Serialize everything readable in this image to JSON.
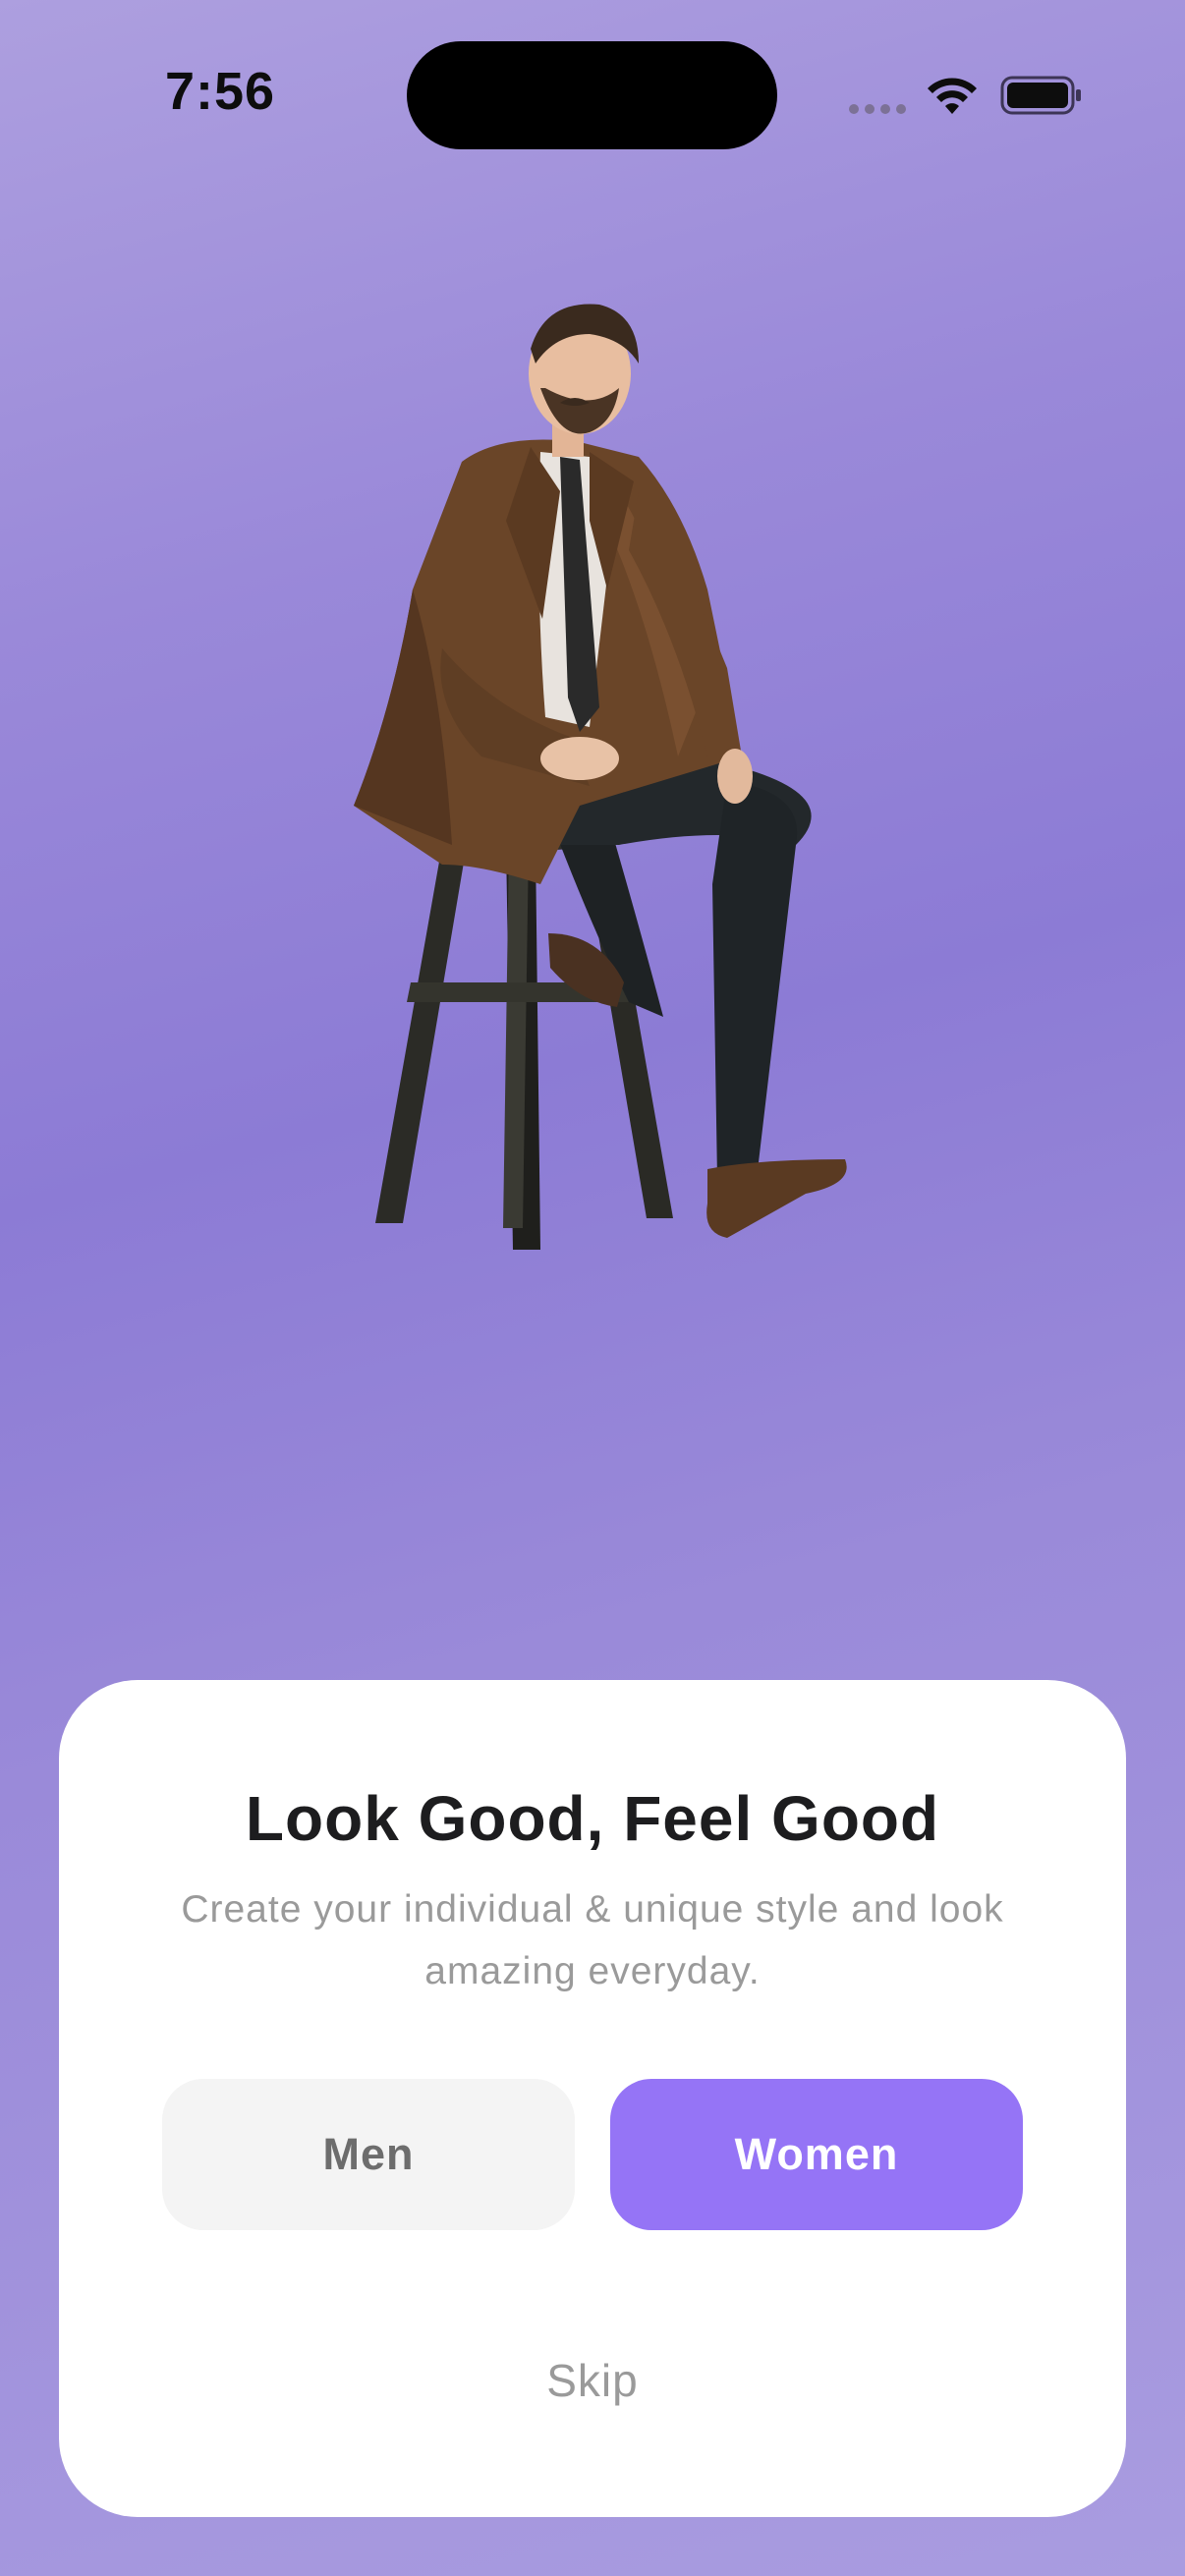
{
  "status_bar": {
    "time": "7:56"
  },
  "hero": {
    "image_alt": "Man in brown trench coat sitting on wooden bar stool"
  },
  "card": {
    "title": "Look Good, Feel Good",
    "subtitle": "Create your individual & unique style and look amazing everyday.",
    "buttons": {
      "men_label": "Men",
      "women_label": "Women"
    },
    "skip_label": "Skip"
  },
  "colors": {
    "background_accent": "#8c7bd5",
    "primary_button": "#9574f6",
    "secondary_button": "#f4f4f4",
    "title_text": "#1d1d1f",
    "muted_text": "#9a9a9a"
  },
  "icons": [
    "cellular-icon",
    "wifi-icon",
    "battery-icon"
  ]
}
